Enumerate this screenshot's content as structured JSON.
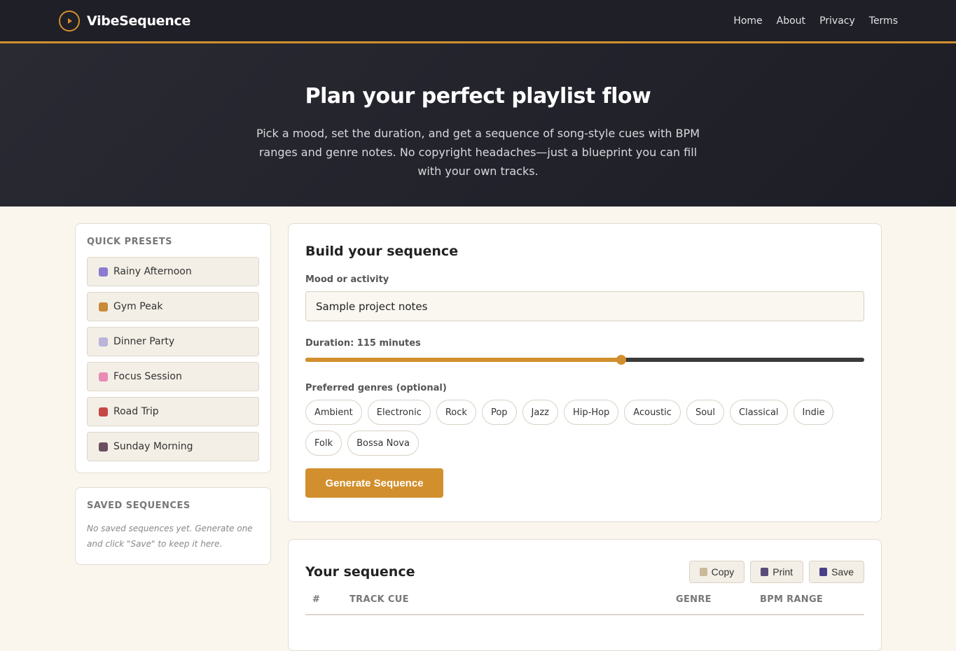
{
  "nav": {
    "brand": "VibeSequence",
    "links": [
      "Home",
      "About",
      "Privacy",
      "Terms"
    ]
  },
  "hero": {
    "title": "Plan your perfect playlist flow",
    "subtitle": "Pick a mood, set the duration, and get a sequence of song-style cues with BPM ranges and genre notes. No copyright headaches—just a blueprint you can fill with your own tracks."
  },
  "sidebar": {
    "presets_title": "Quick Presets",
    "presets": [
      {
        "label": "Rainy Afternoon",
        "icon": "rain-cloud-icon",
        "color": "#8a7bd0"
      },
      {
        "label": "Gym Peak",
        "icon": "dumbbell-icon",
        "color": "#c98a3a"
      },
      {
        "label": "Dinner Party",
        "icon": "plate-icon",
        "color": "#b9b4d8"
      },
      {
        "label": "Focus Session",
        "icon": "brain-icon",
        "color": "#e98bb4"
      },
      {
        "label": "Road Trip",
        "icon": "car-icon",
        "color": "#c74646"
      },
      {
        "label": "Sunday Morning",
        "icon": "coffee-icon",
        "color": "#6b4f5f"
      }
    ],
    "saved_title": "Saved Sequences",
    "saved_empty": "No saved sequences yet. Generate one and click \"Save\" to keep it here."
  },
  "builder": {
    "title": "Build your sequence",
    "mood_label": "Mood or activity",
    "mood_value": "Sample project notes",
    "duration_label": "Duration: 115 minutes",
    "duration_fraction": 0.565,
    "genres_label": "Preferred genres (optional)",
    "genres": [
      "Ambient",
      "Electronic",
      "Rock",
      "Pop",
      "Jazz",
      "Hip-Hop",
      "Acoustic",
      "Soul",
      "Classical",
      "Indie",
      "Folk",
      "Bossa Nova"
    ],
    "generate_label": "Generate Sequence"
  },
  "results": {
    "title": "Your sequence",
    "actions": [
      {
        "label": "Copy",
        "icon": "clipboard-icon",
        "color": "#c9b89a"
      },
      {
        "label": "Print",
        "icon": "printer-icon",
        "color": "#5a4b7a"
      },
      {
        "label": "Save",
        "icon": "floppy-disk-icon",
        "color": "#4a3f8a"
      }
    ],
    "columns": [
      "#",
      "Track Cue",
      "Genre",
      "BPM Range"
    ]
  },
  "colors": {
    "accent": "#d28f2d",
    "nav_bg": "#1f1f27",
    "page_bg": "#faf6ee"
  }
}
